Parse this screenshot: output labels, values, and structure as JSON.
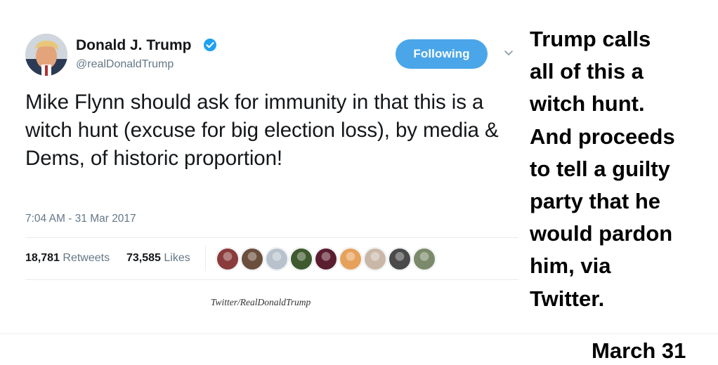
{
  "tweet": {
    "author_name": "Donald J. Trump",
    "handle": "@realDonaldTrump",
    "follow_button_label": "Following",
    "text": "Mike Flynn should ask for immunity in that this is a witch hunt (excuse for big election loss), by media & Dems, of historic proportion!",
    "timestamp": "7:04 AM - 31 Mar 2017",
    "retweets_count": "18,781",
    "retweets_label": "Retweets",
    "likes_count": "73,585",
    "likes_label": "Likes",
    "liker_avatar_colors": [
      "#8a3b3b",
      "#6b4e3d",
      "#b8c2cc",
      "#3f5a2e",
      "#5a1e2e",
      "#e6a15a",
      "#c9b8a8",
      "#4a4a4a",
      "#7a8a6a"
    ],
    "verified_color": "#1da1f2"
  },
  "caption": {
    "credit": "Twitter/RealDonaldTrump",
    "commentary": "Trump calls\nall of this a\nwitch hunt.\nAnd proceeds\nto tell a guilty\nparty that he\nwould pardon\nhim, via\nTwitter.",
    "date_label": "March 31"
  },
  "icons": {
    "verified": "verified-badge-icon",
    "more_options": "chevron-down-icon"
  }
}
